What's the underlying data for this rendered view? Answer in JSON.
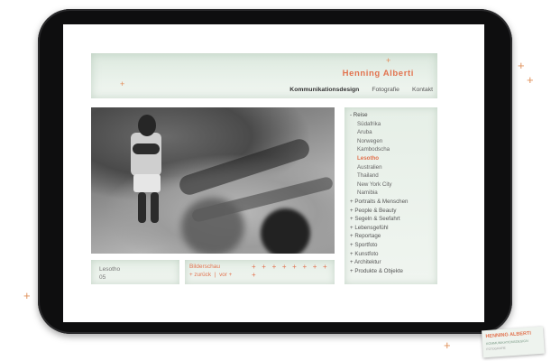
{
  "site": {
    "title": "Henning Alberti",
    "nav": [
      "Kommunikationsdesign",
      "Fotografie",
      "Kontakt"
    ]
  },
  "caption": {
    "place": "Lesotho",
    "number": "05"
  },
  "slideshow": {
    "title": "Bilderschau",
    "plus_row": "+ + + + + + + + +",
    "back": "+ zurück",
    "separator": "|",
    "next": "vor +"
  },
  "menu": {
    "section": "- Reise",
    "items": [
      "Südafrika",
      "Aruba",
      "Norwegen",
      "Kambodscha",
      "Lesotho",
      "Australien",
      "Thailand",
      "New York City",
      "Namibia"
    ],
    "current_index": 4,
    "categories": [
      "+ Portraits & Menschen",
      "+ People & Beauty",
      "+ Segeln & Seefahrt",
      "+ Lebensgefühl",
      "+ Reportage",
      "+ Sportfoto",
      "+ Kunstfoto",
      "+ Architektur",
      "+ Produkte & Objekte"
    ]
  },
  "card": {
    "name": "HENNING ALBERTI",
    "line2": "KOMMUNIKATIONSDESIGN",
    "line3": "FOTOGRAFIE"
  },
  "colors": {
    "accent": "#e2734f",
    "panel": "#e6efe7",
    "bezel": "#0e0e0f"
  },
  "icons": {
    "plus": "+"
  }
}
